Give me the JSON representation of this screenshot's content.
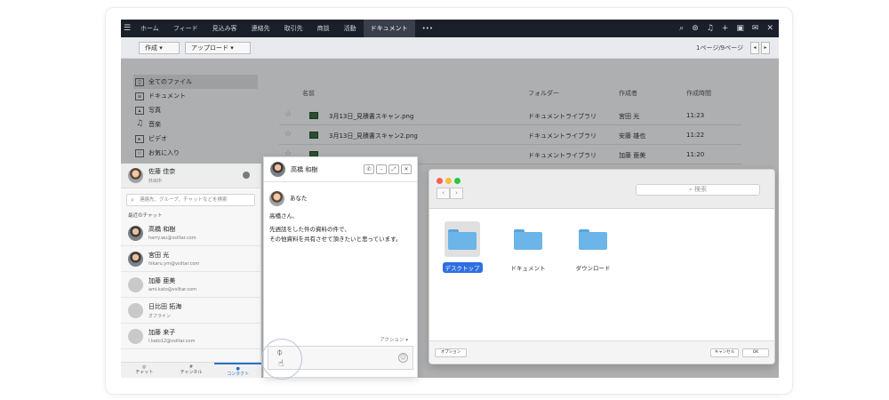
{
  "topnav": {
    "items": [
      "ホーム",
      "フィード",
      "見込み客",
      "連絡先",
      "取引先",
      "商談",
      "活動",
      "ドキュメント"
    ],
    "active_index": 7
  },
  "toolbar": {
    "create_label": "作成",
    "upload_label": "アップロード",
    "page_info": "1ページ/9ページ"
  },
  "sidebar": {
    "items": [
      "全てのファイル",
      "ドキュメント",
      "写真",
      "音楽",
      "ビデオ",
      "お気に入り"
    ]
  },
  "table": {
    "headers": [
      "名前",
      "フォルダー",
      "作成者",
      "作成時間"
    ],
    "rows": [
      {
        "name": "3月13日_見積書スキャン.png",
        "folder": "ドキュメントライブラリ",
        "author": "宮田 光",
        "time": "11:23"
      },
      {
        "name": "3月13日_見積書スキャン2.png",
        "folder": "ドキュメントライブラリ",
        "author": "安藤 雄也",
        "time": "11:22"
      },
      {
        "name": "",
        "folder": "ドキュメントライブラリ",
        "author": "加藤 亜美",
        "time": "11:20"
      }
    ]
  },
  "chat": {
    "me": {
      "name": "佐藤 佳奈",
      "status": "外出中"
    },
    "search_placeholder": "連絡先、グループ、チャットなどを検索",
    "section_title": "最近のチャット",
    "contacts": [
      {
        "name": "高橋 和樹",
        "email": "harry.wu@vsiltar.com"
      },
      {
        "name": "宮田 光",
        "email": "hikaru.ym@vsiltar.com"
      },
      {
        "name": "加藤 亜美",
        "email": "ami.kato@vsiltar.com"
      },
      {
        "name": "日比田 拓海",
        "email": "オフライン"
      },
      {
        "name": "加藤 来子",
        "email": "l.kato12@vsiltar.com"
      }
    ],
    "tabs": [
      "チャット",
      "チャンネル",
      "コンタクト"
    ]
  },
  "chat_window": {
    "contact_name": "高橋 和樹",
    "sender_label": "あなた",
    "greeting": "高橋さん、",
    "line1": "先週話をした件の資料の件で、",
    "line2": "その他資料を共有させて頂きたいと思っています。",
    "action_label": "アクション"
  },
  "finder": {
    "search_placeholder": "検索",
    "folders": [
      "デスクトップ",
      "ドキュメント",
      "ダウンロード"
    ],
    "options_label": "オプション",
    "cancel_label": "キャンセル",
    "ok_label": "OK"
  }
}
